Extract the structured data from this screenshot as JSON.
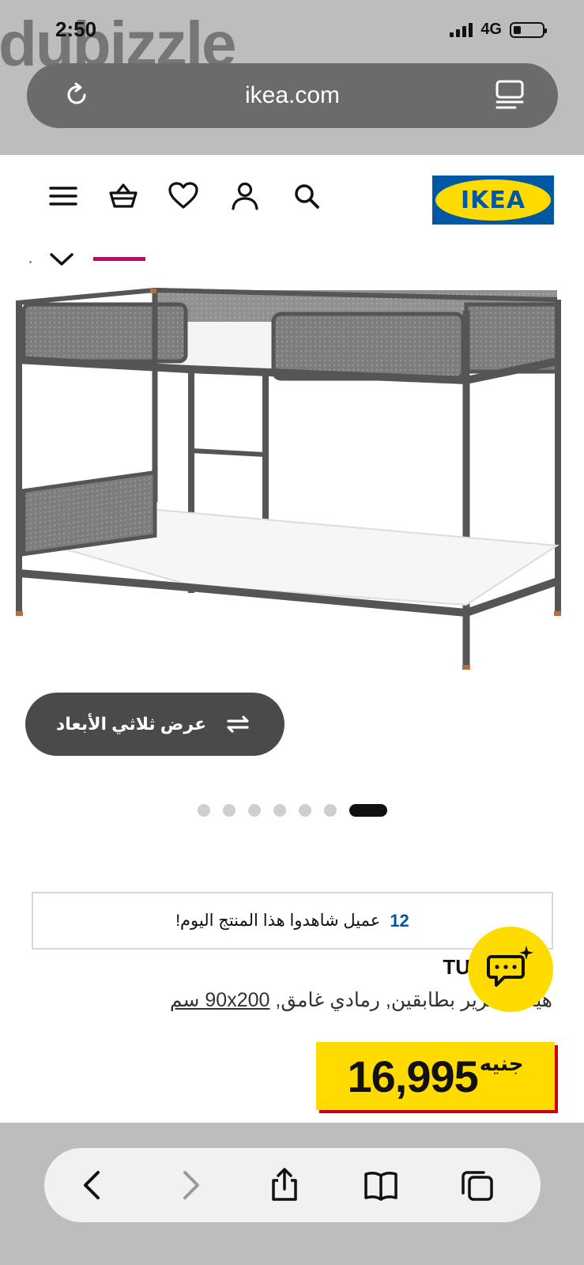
{
  "status_bar": {
    "time": "2:50",
    "network": "4G",
    "watermark": "dubizzle"
  },
  "browser": {
    "url": "ikea.com",
    "icons": {
      "reload": "reload-icon",
      "reader": "reader-mode-icon"
    }
  },
  "header": {
    "logo_text": "IKEA",
    "icons": [
      "menu-icon",
      "cart-icon",
      "heart-icon",
      "user-icon",
      "search-icon"
    ],
    "colors": {
      "brand_blue": "#0058a3",
      "brand_yellow": "#ffdb00",
      "tab_accent": "#cc0066"
    }
  },
  "gallery": {
    "view_3d_label": "عرض ثلاثي الأبعاد",
    "dot_count": 7,
    "active_dot": 7
  },
  "social_proof": {
    "count": "12",
    "text": "عميل شاهدوا هذا المنتج اليوم!"
  },
  "product": {
    "name_partial": "TU",
    "description_prefix": "هيكل سرير بطابقين, رمادي غامق,",
    "size_link": "90x200 سم",
    "price_value": "16,995",
    "price_currency": "جنيه",
    "price_accent": "#cc0008"
  },
  "toolbar": {
    "icons": [
      "back-icon",
      "forward-icon",
      "share-icon",
      "bookmarks-icon",
      "tabs-icon"
    ]
  }
}
